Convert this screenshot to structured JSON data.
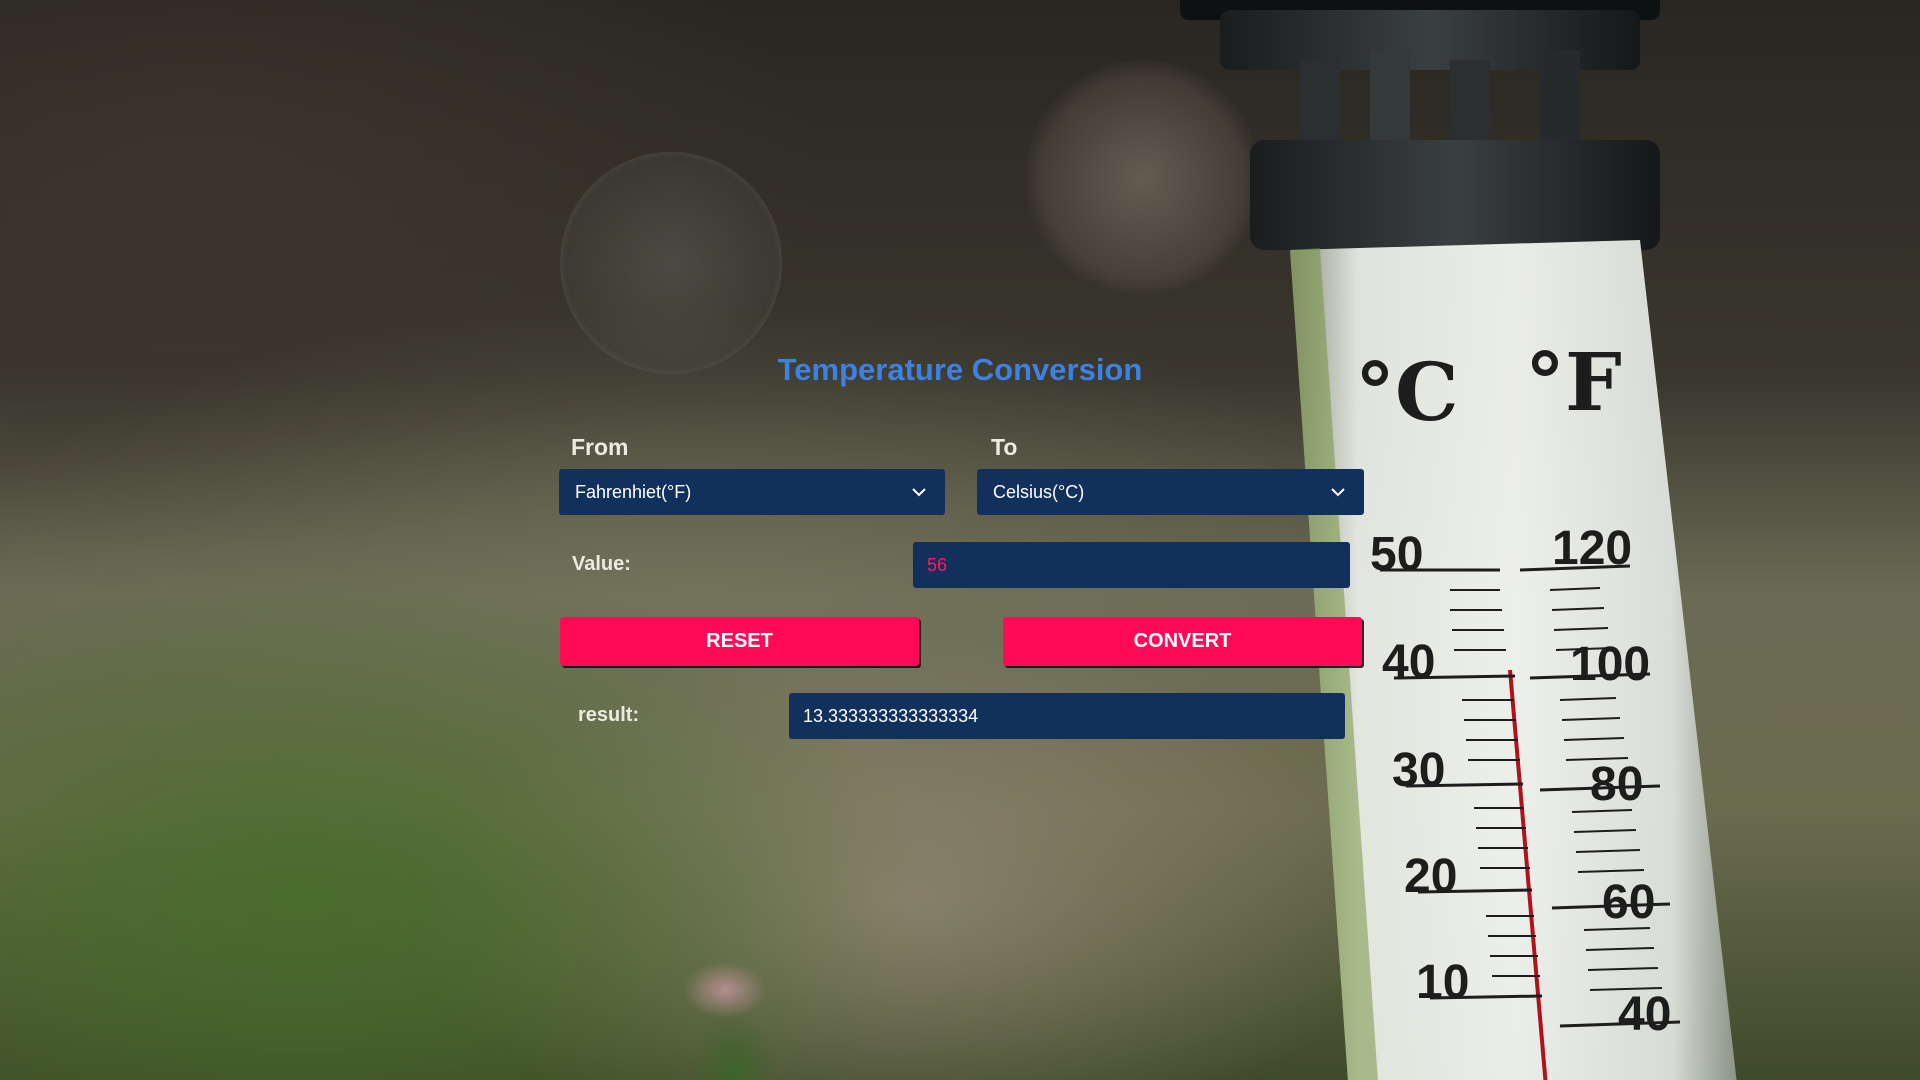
{
  "title": "Temperature Conversion",
  "from": {
    "label": "From",
    "selected": "Fahrenhiet(°F)"
  },
  "to": {
    "label": "To",
    "selected": "Celsius(°C)"
  },
  "value": {
    "label": "Value:",
    "input_value": "56"
  },
  "buttons": {
    "reset": "RESET",
    "convert": "CONVERT"
  },
  "result": {
    "label": "result:",
    "output_value": "13.333333333333334"
  },
  "thermometer": {
    "unit_left": "°C",
    "unit_right": "°F",
    "celsius_ticks": [
      "50",
      "40",
      "30",
      "20",
      "10"
    ],
    "fahrenheit_ticks": [
      "120",
      "100",
      "80",
      "60",
      "40"
    ]
  },
  "colors": {
    "title": "#3d82e3",
    "field_bg": "#12305c",
    "button_bg": "#ff0a55",
    "value_text": "#ff1a5e"
  },
  "icons": {
    "dropdown": "chevron-down-icon"
  }
}
